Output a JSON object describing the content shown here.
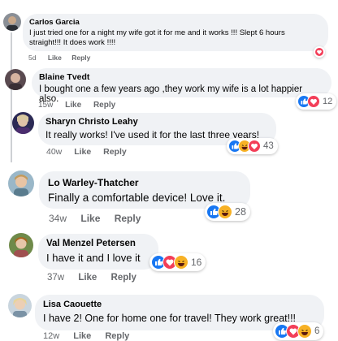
{
  "colors": {
    "like": "#1877f2",
    "love": "#f33e58",
    "haha": "#f7b125",
    "bubble": "#f0f2f5",
    "meta": "#65676b"
  },
  "comments": [
    {
      "author": "Carlos Garcia",
      "text": "I just tried one for a night my wife got it for me and it works !!! Slept 6 hours\nstraight!!! It does work !!!!",
      "time": "5d",
      "like": "Like",
      "reply": "Reply",
      "reactions": [
        "love-icon"
      ],
      "count": ""
    },
    {
      "author": "Blaine Tvedt",
      "text": "I bought one a few years ago ,they work my wife is a lot happier also.",
      "time": "15w",
      "like": "Like",
      "reply": "Reply",
      "reactions": [
        "like-icon",
        "love-icon"
      ],
      "count": "12"
    },
    {
      "author": "Sharyn Christo Leahy",
      "text": "It really works! I've used it for the last three years!",
      "time": "40w",
      "like": "Like",
      "reply": "Reply",
      "reactions": [
        "like-icon",
        "haha-icon",
        "love-icon"
      ],
      "count": "43"
    },
    {
      "author": "Lo Warley-Thatcher",
      "text": "Finally a comfortable device! Love it.",
      "time": "34w",
      "like": "Like",
      "reply": "Reply",
      "reactions": [
        "like-icon",
        "haha-icon"
      ],
      "count": "28"
    },
    {
      "author": "Val Menzel Petersen",
      "text": "I have it and I love it",
      "time": "37w",
      "like": "Like",
      "reply": "Reply",
      "reactions": [
        "like-icon",
        "love-icon",
        "haha-icon"
      ],
      "count": "16"
    },
    {
      "author": "Lisa Caouette",
      "text": "I have 2! One for home one for travel! They work great!!!",
      "time": "12w",
      "like": "Like",
      "reply": "Reply",
      "reactions": [
        "like-icon",
        "love-icon",
        "haha-icon"
      ],
      "count": "6"
    }
  ]
}
